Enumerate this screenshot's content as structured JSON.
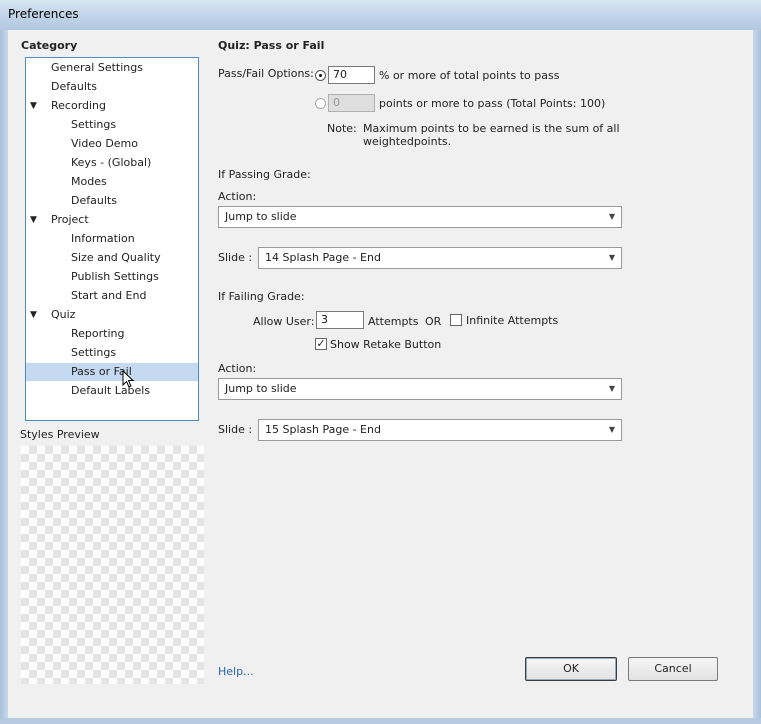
{
  "window": {
    "title": "Preferences"
  },
  "category": {
    "heading": "Category",
    "items": [
      {
        "label": "General Settings",
        "level": 1,
        "expander": ""
      },
      {
        "label": "Defaults",
        "level": 1,
        "expander": ""
      },
      {
        "label": "Recording",
        "level": 1,
        "expander": "▼"
      },
      {
        "label": "Settings",
        "level": 2,
        "expander": ""
      },
      {
        "label": "Video Demo",
        "level": 2,
        "expander": ""
      },
      {
        "label": "Keys - (Global)",
        "level": 2,
        "expander": ""
      },
      {
        "label": "Modes",
        "level": 2,
        "expander": ""
      },
      {
        "label": "Defaults",
        "level": 2,
        "expander": ""
      },
      {
        "label": "Project",
        "level": 1,
        "expander": "▼"
      },
      {
        "label": "Information",
        "level": 2,
        "expander": ""
      },
      {
        "label": "Size and Quality",
        "level": 2,
        "expander": ""
      },
      {
        "label": "Publish Settings",
        "level": 2,
        "expander": ""
      },
      {
        "label": "Start and End",
        "level": 2,
        "expander": ""
      },
      {
        "label": "Quiz",
        "level": 1,
        "expander": "▼"
      },
      {
        "label": "Reporting",
        "level": 2,
        "expander": ""
      },
      {
        "label": "Settings",
        "level": 2,
        "expander": ""
      },
      {
        "label": "Pass or Fail",
        "level": 2,
        "expander": "",
        "selected": true
      },
      {
        "label": "Default Labels",
        "level": 2,
        "expander": ""
      }
    ]
  },
  "styles_preview": {
    "heading": "Styles Preview"
  },
  "panel": {
    "title": "Quiz: Pass or Fail",
    "options_label": "Pass/Fail Options:",
    "percent_value": "70",
    "percent_text": "% or more of total points to pass",
    "points_value": "0",
    "points_text": "points or more to pass (Total Points: 100)",
    "note_label": "Note:",
    "note_line1": "Maximum points to be earned is the sum of all",
    "note_line2": "weightedpoints.",
    "passing": {
      "heading": "If Passing Grade:",
      "action_label": "Action:",
      "action_value": "Jump to slide",
      "slide_label": "Slide :",
      "slide_value": "14 Splash Page - End"
    },
    "failing": {
      "heading": "If Failing Grade:",
      "allow_label": "Allow User:",
      "attempts_value": "3",
      "attempts_text": "Attempts",
      "or_text": "OR",
      "infinite_label": "Infinite Attempts",
      "retake_label": "Show Retake Button",
      "retake_checked": "✓",
      "action_label": "Action:",
      "action_value": "Jump to slide",
      "slide_label": "Slide :",
      "slide_value": "15 Splash Page - End"
    }
  },
  "footer": {
    "help": "Help...",
    "ok": "OK",
    "cancel": "Cancel"
  },
  "colors": {
    "selection": "#c4d8f0",
    "tree_border": "#4a8cc4",
    "link": "#2a66b3"
  }
}
